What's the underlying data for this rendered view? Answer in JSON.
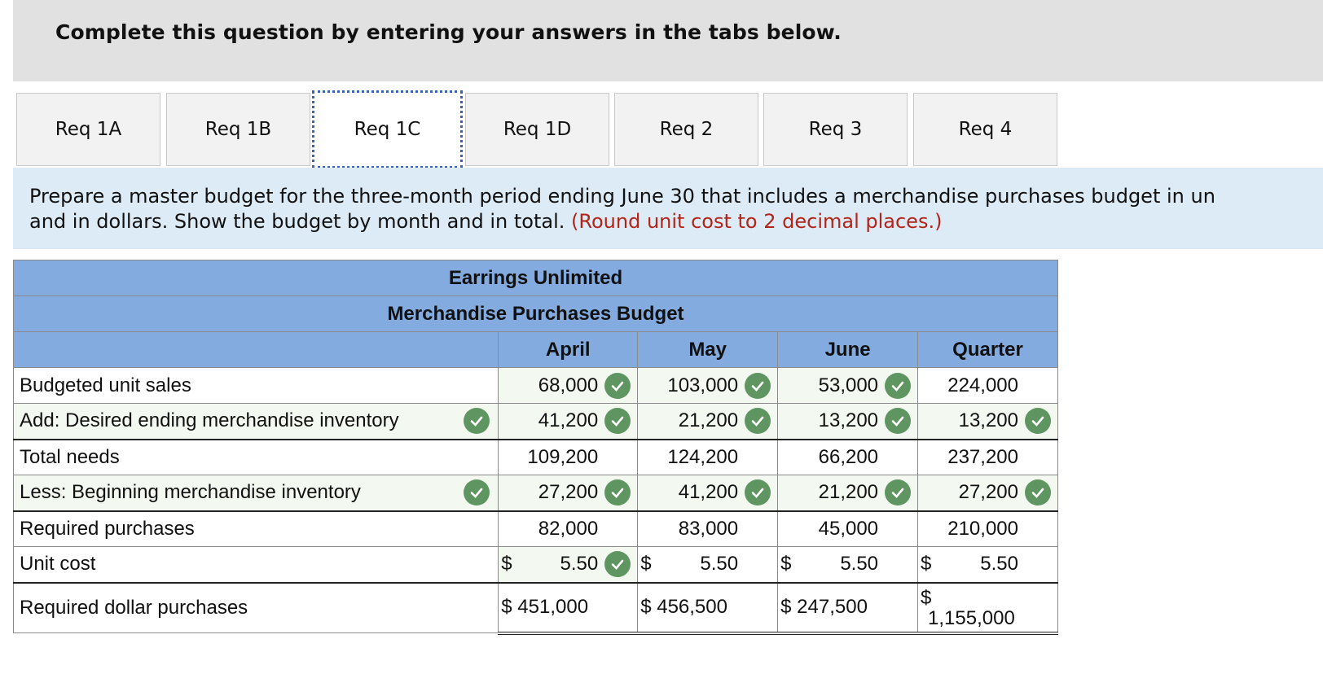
{
  "header": {
    "title": "Complete this question by entering your answers in the tabs below."
  },
  "tabs": [
    {
      "label": "Req 1A"
    },
    {
      "label": "Req 1B"
    },
    {
      "label": "Req 1C"
    },
    {
      "label": "Req 1D"
    },
    {
      "label": "Req 2"
    },
    {
      "label": "Req 3"
    },
    {
      "label": "Req 4"
    }
  ],
  "active_tab": "Req 1C",
  "instruction": {
    "main": "Prepare a master budget for the three-month period ending June 30 that includes a merchandise purchases budget in un and in dollars. Show the budget by month and in total.",
    "line1": "Prepare a master budget for the three-month period ending June 30 that includes a merchandise purchases budget in un",
    "line2": "and in dollars. Show the budget by month and in total.",
    "note": "(Round unit cost to 2 decimal places.)"
  },
  "table": {
    "company": "Earrings Unlimited",
    "title": "Merchandise Purchases Budget",
    "columns": [
      "April",
      "May",
      "June",
      "Quarter"
    ],
    "rows": [
      {
        "label": "Budgeted unit sales",
        "values": [
          "68,000",
          "103,000",
          "53,000",
          "224,000"
        ]
      },
      {
        "label": "Add: Desired ending merchandise inventory",
        "values": [
          "41,200",
          "21,200",
          "13,200",
          "13,200"
        ]
      },
      {
        "label": "Total needs",
        "values": [
          "109,200",
          "124,200",
          "66,200",
          "237,200"
        ]
      },
      {
        "label": "Less: Beginning merchandise inventory",
        "values": [
          "27,200",
          "41,200",
          "21,200",
          "27,200"
        ]
      },
      {
        "label": "Required purchases",
        "values": [
          "82,000",
          "83,000",
          "45,000",
          "210,000"
        ]
      },
      {
        "label": "Unit cost",
        "dollar": "$",
        "values": [
          "5.50",
          "5.50",
          "5.50",
          "5.50"
        ]
      },
      {
        "label": "Required dollar purchases",
        "dollar": "$",
        "values": [
          "451,000",
          "456,500",
          "247,500",
          "1,155,000"
        ]
      }
    ]
  },
  "colors": {
    "header_bg": "#e1e1e1",
    "table_header": "#83abe0",
    "instruction_bg": "#ddebf7",
    "check": "#5f9560",
    "note": "#b42318"
  }
}
